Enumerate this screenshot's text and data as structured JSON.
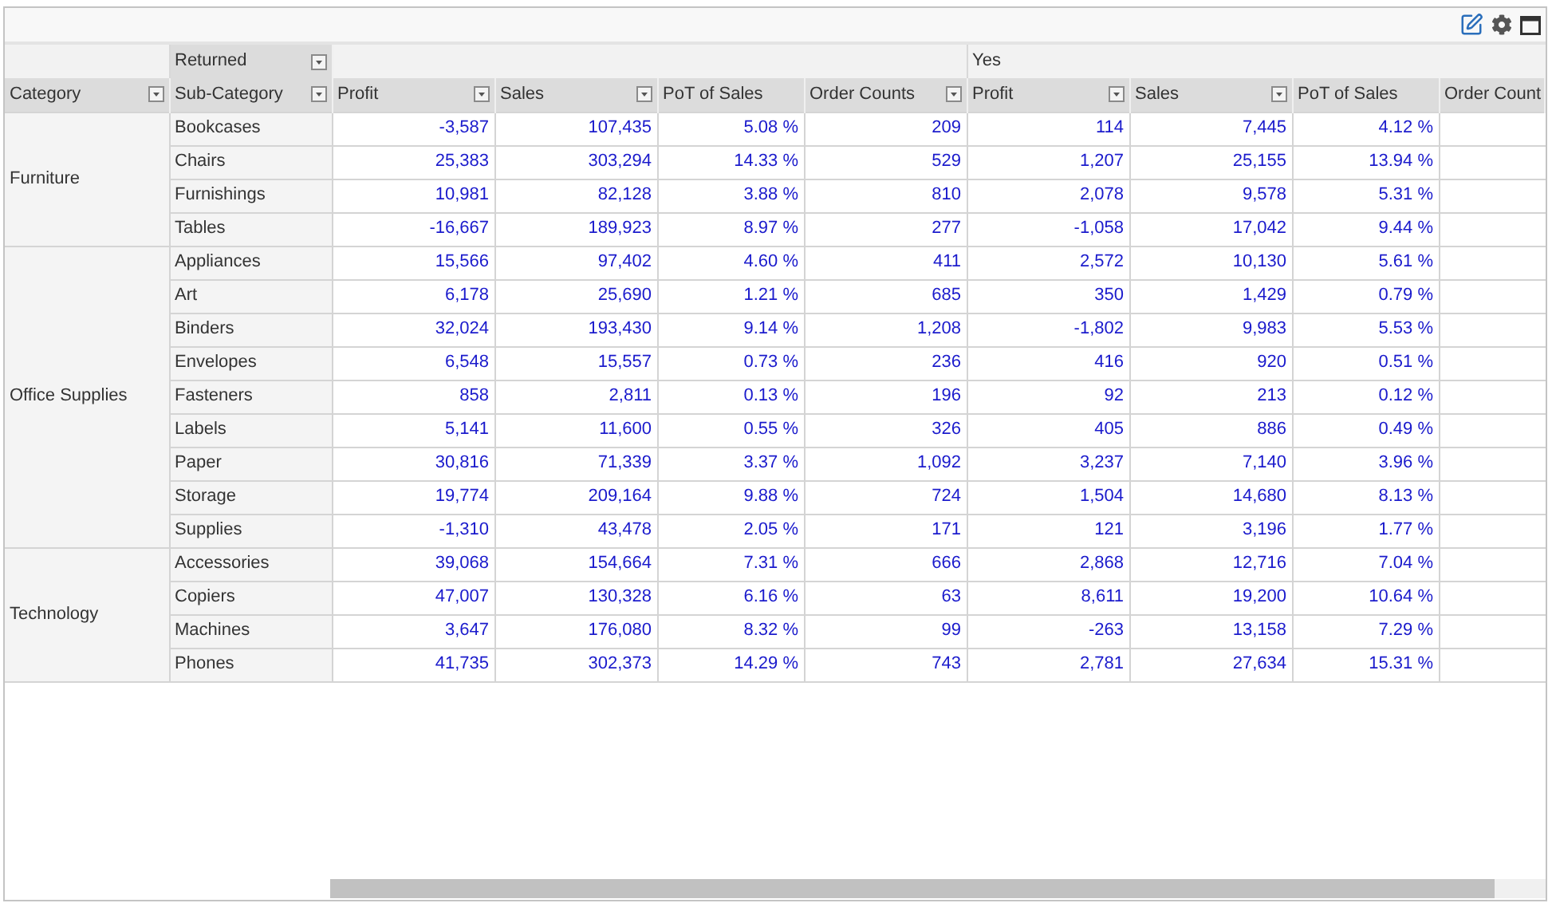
{
  "toolbar": {
    "buttons": [
      {
        "kind": "edit"
      },
      {
        "kind": "settings"
      },
      {
        "kind": "maximize"
      }
    ]
  },
  "column_header": {
    "field": "Returned",
    "filter": true,
    "groups": [
      {
        "columns": [
          {
            "label": "Profit",
            "filter": true
          },
          {
            "label": "Sales",
            "filter": true
          },
          {
            "label": "PoT of Sales",
            "filter": false
          },
          {
            "label": "Order Counts",
            "filter": true
          }
        ]
      },
      {
        "label": "Yes",
        "columns": [
          {
            "label": "Profit",
            "filter": true
          },
          {
            "label": "Sales",
            "filter": true
          },
          {
            "label": "PoT of Sales",
            "filter": false
          },
          {
            "label": "Order Count",
            "filter": false
          }
        ]
      }
    ]
  },
  "row_fields": [
    {
      "label": "Category",
      "filter": true
    },
    {
      "label": "Sub-Category",
      "filter": true
    }
  ],
  "rows": [
    {
      "category": "Furniture",
      "children": [
        {
          "name": "Bookcases",
          "values": [
            "-3,587",
            "107,435",
            "5.08 %",
            "209",
            "114",
            "7,445",
            "4.12 %"
          ]
        },
        {
          "name": "Chairs",
          "values": [
            "25,383",
            "303,294",
            "14.33 %",
            "529",
            "1,207",
            "25,155",
            "13.94 %"
          ]
        },
        {
          "name": "Furnishings",
          "values": [
            "10,981",
            "82,128",
            "3.88 %",
            "810",
            "2,078",
            "9,578",
            "5.31 %"
          ]
        },
        {
          "name": "Tables",
          "values": [
            "-16,667",
            "189,923",
            "8.97 %",
            "277",
            "-1,058",
            "17,042",
            "9.44 %"
          ]
        }
      ]
    },
    {
      "category": "Office Supplies",
      "children": [
        {
          "name": "Appliances",
          "values": [
            "15,566",
            "97,402",
            "4.60 %",
            "411",
            "2,572",
            "10,130",
            "5.61 %"
          ]
        },
        {
          "name": "Art",
          "values": [
            "6,178",
            "25,690",
            "1.21 %",
            "685",
            "350",
            "1,429",
            "0.79 %"
          ]
        },
        {
          "name": "Binders",
          "values": [
            "32,024",
            "193,430",
            "9.14 %",
            "1,208",
            "-1,802",
            "9,983",
            "5.53 %"
          ]
        },
        {
          "name": "Envelopes",
          "values": [
            "6,548",
            "15,557",
            "0.73 %",
            "236",
            "416",
            "920",
            "0.51 %"
          ]
        },
        {
          "name": "Fasteners",
          "values": [
            "858",
            "2,811",
            "0.13 %",
            "196",
            "92",
            "213",
            "0.12 %"
          ]
        },
        {
          "name": "Labels",
          "values": [
            "5,141",
            "11,600",
            "0.55 %",
            "326",
            "405",
            "886",
            "0.49 %"
          ]
        },
        {
          "name": "Paper",
          "values": [
            "30,816",
            "71,339",
            "3.37 %",
            "1,092",
            "3,237",
            "7,140",
            "3.96 %"
          ]
        },
        {
          "name": "Storage",
          "values": [
            "19,774",
            "209,164",
            "9.88 %",
            "724",
            "1,504",
            "14,680",
            "8.13 %"
          ]
        },
        {
          "name": "Supplies",
          "values": [
            "-1,310",
            "43,478",
            "2.05 %",
            "171",
            "121",
            "3,196",
            "1.77 %"
          ]
        }
      ]
    },
    {
      "category": "Technology",
      "children": [
        {
          "name": "Accessories",
          "values": [
            "39,068",
            "154,664",
            "7.31 %",
            "666",
            "2,868",
            "12,716",
            "7.04 %"
          ]
        },
        {
          "name": "Copiers",
          "values": [
            "47,007",
            "130,328",
            "6.16 %",
            "63",
            "8,611",
            "19,200",
            "10.64 %"
          ]
        },
        {
          "name": "Machines",
          "values": [
            "3,647",
            "176,080",
            "8.32 %",
            "99",
            "-263",
            "13,158",
            "7.29 %"
          ]
        },
        {
          "name": "Phones",
          "values": [
            "41,735",
            "302,373",
            "14.29 %",
            "743",
            "2,781",
            "27,634",
            "15.31 %"
          ]
        }
      ]
    }
  ]
}
